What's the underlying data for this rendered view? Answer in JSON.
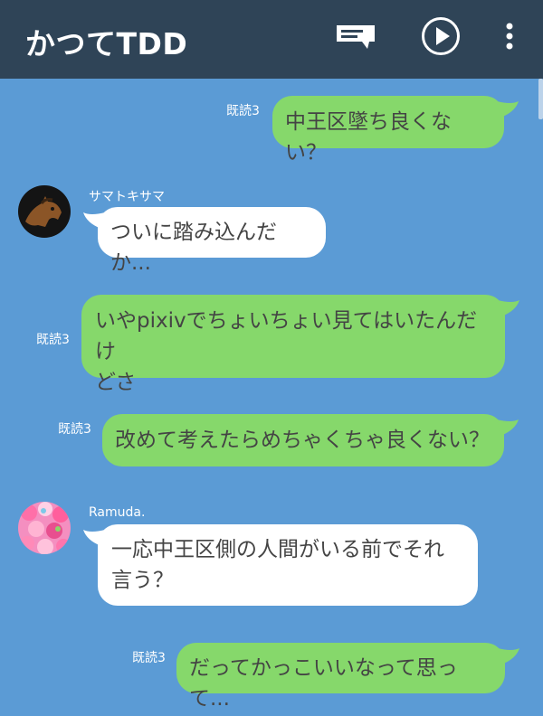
{
  "header": {
    "title": "かつてTDD",
    "icons": [
      "note-icon",
      "play-icon",
      "more-vertical-icon"
    ]
  },
  "colors": {
    "header_bg": "#2f4457",
    "chat_bg": "#5b9bd5",
    "outgoing_bubble": "#86d86b",
    "incoming_bubble": "#ffffff"
  },
  "messages": [
    {
      "direction": "outgoing",
      "read": "既読3",
      "text": "中王区墜ち良くない？"
    },
    {
      "direction": "incoming",
      "sender": "サマトキサマ",
      "avatar": "horse-avatar",
      "text": "ついに踏み込んだか..."
    },
    {
      "direction": "outgoing",
      "read": "既読3",
      "lines": [
        "いやpixivでちょいちょい見てはいたんだけ",
        "どさ"
      ]
    },
    {
      "direction": "outgoing",
      "read": "既読3",
      "text": "改めて考えたらめちゃくちゃ良くない？"
    },
    {
      "direction": "incoming",
      "sender": "Ramuda.",
      "avatar": "candy-avatar",
      "lines": [
        "一応中王区側の人間がいる前でそれ",
        "言う？"
      ]
    },
    {
      "direction": "outgoing",
      "read": "既読3",
      "text": "だってかっこいいなって思って..."
    }
  ]
}
